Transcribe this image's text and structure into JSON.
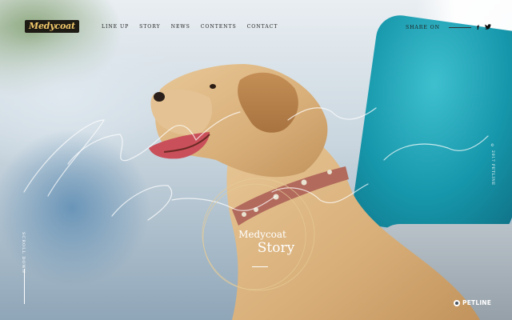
{
  "logo": {
    "text": "Medycoat"
  },
  "nav": {
    "items": [
      {
        "label": "LINE UP"
      },
      {
        "label": "STORY"
      },
      {
        "label": "NEWS"
      },
      {
        "label": "CONTENTS"
      },
      {
        "label": "CONTACT"
      }
    ]
  },
  "share": {
    "label": "SHARE ON",
    "facebook": "f",
    "twitter": "t"
  },
  "side_left": {
    "text": "SCROLL DOWN"
  },
  "side_right": {
    "text": "© 2017 PETLINE"
  },
  "story": {
    "line1": "Medycoat",
    "line2": "Story"
  },
  "brand": {
    "text": "PETLINE"
  }
}
